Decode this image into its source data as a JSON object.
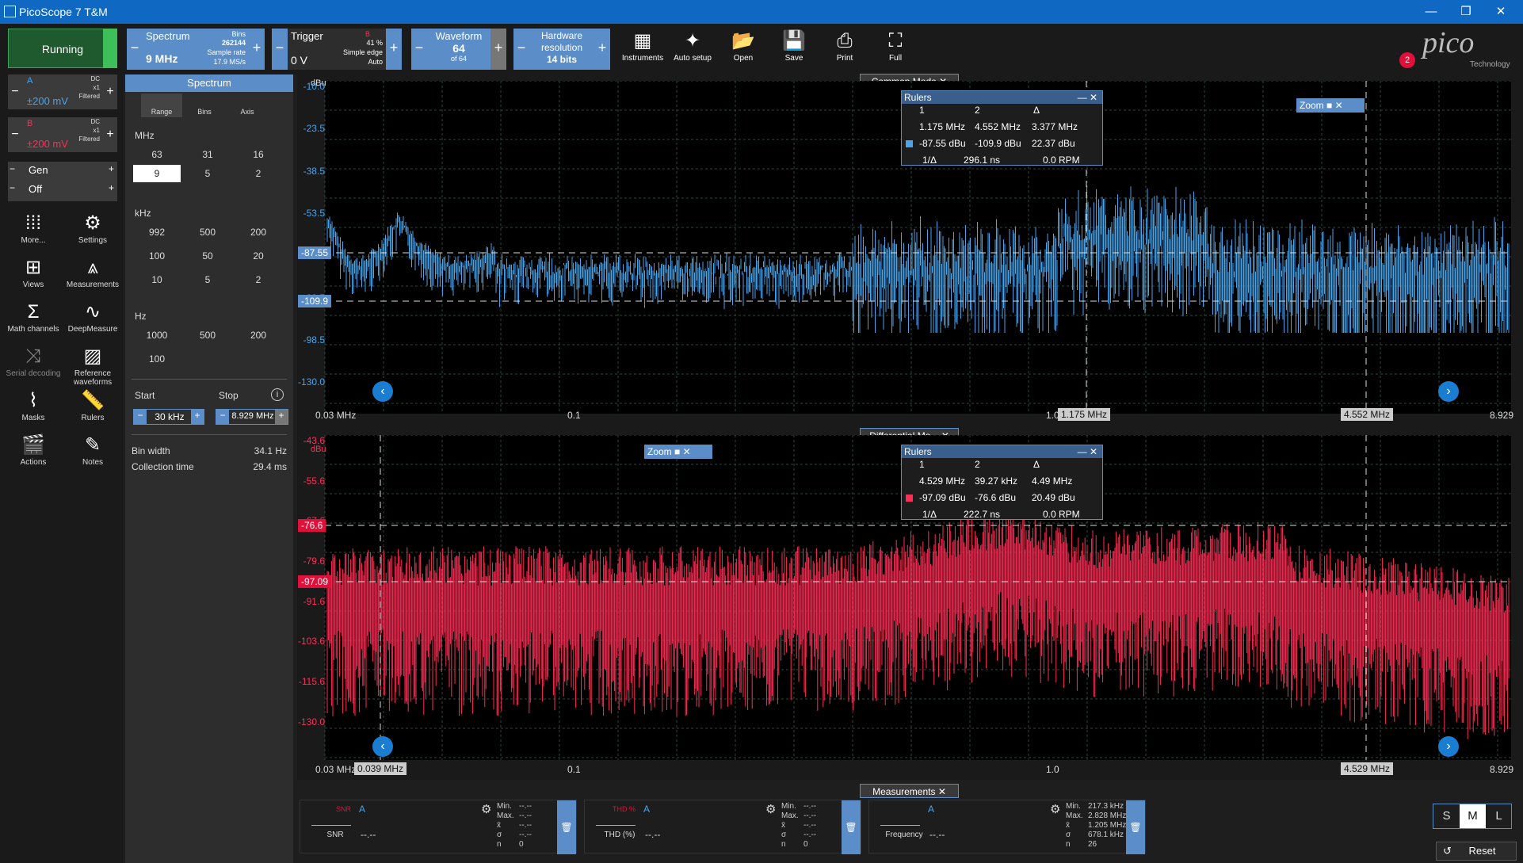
{
  "app": {
    "title": "PicoScope 7 T&M",
    "minimize": "—",
    "restore": "❐",
    "close": "✕"
  },
  "toolbar": {
    "run_status": "Running",
    "mode_label": "Spectrum",
    "mode_value": "9 MHz",
    "bins_label": "Bins",
    "bins_value": "262144",
    "sample_rate_label": "Sample rate",
    "sample_rate_value": "17.9 MS/s",
    "trigger_label": "Trigger",
    "trigger_value": "0 V",
    "trigger_channel": "B",
    "trigger_pct": "41 %",
    "trigger_type": "Simple edge",
    "trigger_mode": "Auto",
    "waveform_label": "Waveform",
    "waveform_value": "64",
    "waveform_of": "of 64",
    "hw_label": "Hardware resolution",
    "hw_value": "14 bits",
    "buttons": {
      "instruments": "Instruments",
      "auto_setup": "Auto setup",
      "open": "Open",
      "save": "Save",
      "print": "Print",
      "full": "Full"
    },
    "logo": "pico",
    "logo_sub": "Technology",
    "notifications": "2"
  },
  "channels": [
    {
      "name": "A",
      "coupling": "DC",
      "probe": "x1",
      "filter": "Filtered",
      "range": "±200 mV",
      "color": "#4aa3e8"
    },
    {
      "name": "B",
      "coupling": "DC",
      "probe": "x1",
      "filter": "Filtered",
      "range": "±200 mV",
      "color": "#ff2d55"
    }
  ],
  "gen": {
    "label": "Gen",
    "state": "Off"
  },
  "nav": {
    "more": "More...",
    "settings": "Settings",
    "views": "Views",
    "measurements": "Measurements",
    "math": "Math channels",
    "deepmeasure": "DeepMeasure",
    "serial": "Serial decoding",
    "reference": "Reference waveforms",
    "masks": "Masks",
    "rulers": "Rulers",
    "actions": "Actions",
    "notes": "Notes"
  },
  "spectrum_panel": {
    "title": "Spectrum",
    "tabs": [
      "Range",
      "Bins",
      "Axis"
    ],
    "mhz_label": "MHz",
    "mhz": [
      "63",
      "31",
      "16",
      "9",
      "5",
      "2"
    ],
    "khz_label": "kHz",
    "khz": [
      "992",
      "500",
      "200",
      "100",
      "50",
      "20",
      "10",
      "5",
      "2"
    ],
    "hz_label": "Hz",
    "hz": [
      "1000",
      "500",
      "200",
      "100"
    ],
    "start_label": "Start",
    "stop_label": "Stop",
    "start_value": "30 kHz",
    "stop_value": "8.929 MHz",
    "bin_width_label": "Bin width",
    "bin_width_value": "34.1 Hz",
    "collection_label": "Collection time",
    "collection_value": "29.4 ms"
  },
  "plot1": {
    "title": "Common Mode",
    "unit": "dBu",
    "yticks": [
      "-10.0",
      "-23.5",
      "-38.5",
      "-53.5",
      "-68.5",
      "-83.5",
      "-98.5",
      "-130.0"
    ],
    "xticks": [
      "0.03 MHz",
      "0.1",
      "1.0",
      "8.929"
    ],
    "marker_left": "-87.55",
    "marker_left2": "-109.9",
    "ruler_x1": "1.175 MHz",
    "ruler_x2": "4.552 MHz",
    "rulers": {
      "title": "Rulers",
      "c1": "1",
      "c2": "2",
      "cd": "Δ",
      "f1": "1.175 MHz",
      "f2": "4.552 MHz",
      "fd": "3.377 MHz",
      "v1": "-87.55 dBu",
      "v2": "-109.9 dBu",
      "vd": "22.37 dBu",
      "inv": "1/Δ",
      "t": "296.1 ns",
      "rpm": "0.0 RPM"
    },
    "zoom": "Zoom"
  },
  "plot2": {
    "title": "Differential Mo...",
    "unit": "dBu",
    "yticks": [
      "-43.6",
      "-55.6",
      "-67.6",
      "-79.6",
      "-91.6",
      "-103.6",
      "-115.6",
      "-130.0"
    ],
    "xticks": [
      "0.03 MHz",
      "0.1",
      "1.0",
      "8.929"
    ],
    "marker_left": "-76.6",
    "marker_left2": "-97.09",
    "ruler_x1": "0.039 MHz",
    "ruler_x2": "4.529 MHz",
    "rulers": {
      "title": "Rulers",
      "c1": "1",
      "c2": "2",
      "cd": "Δ",
      "f1": "4.529 MHz",
      "f2": "39.27 kHz",
      "fd": "4.49 MHz",
      "v1": "-97.09 dBu",
      "v2": "-76.6 dBu",
      "vd": "20.49 dBu",
      "inv": "1/Δ",
      "t": "222.7 ns",
      "rpm": "0.0 RPM"
    },
    "zoom": "Zoom"
  },
  "measurements": {
    "title": "Measurements",
    "items": [
      {
        "name": "SNR",
        "icon_text": "SNR",
        "channel": "A",
        "value": "--.--",
        "min": "--.--",
        "max": "--.--",
        "mean": "--.--",
        "sd": "--.--",
        "n": "0"
      },
      {
        "name": "THD (%)",
        "icon_text": "THD %",
        "channel": "A",
        "value": "--.--",
        "min": "--.--",
        "max": "--.--",
        "mean": "--.--",
        "sd": "--.--",
        "n": "0"
      },
      {
        "name": "Frequency",
        "icon_text": "",
        "channel": "A",
        "value": "--.--",
        "min": "217.3 kHz",
        "max": "2.828 MHz",
        "mean": "1.205 MHz",
        "sd": "678.1 kHz",
        "n": "26"
      }
    ],
    "labels": {
      "min": "Min.",
      "max": "Max.",
      "mean": "x̄",
      "sd": "σ",
      "n": "n"
    }
  },
  "sizes": {
    "s": "S",
    "m": "M",
    "l": "L"
  },
  "reset": "Reset"
}
